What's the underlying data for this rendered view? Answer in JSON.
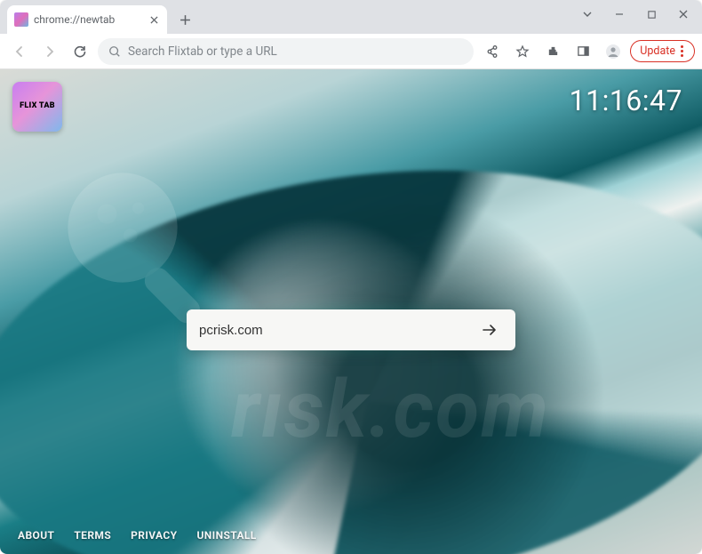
{
  "tab": {
    "title": "chrome://newtab"
  },
  "omnibox": {
    "placeholder": "Search Flixtab or type a URL"
  },
  "update_button": {
    "label": "Update"
  },
  "newtab": {
    "logo_text": "FLIX TAB",
    "clock": "11:16:47",
    "search_value": "pcrisk.com",
    "footer": [
      "ABOUT",
      "TERMS",
      "PRIVACY",
      "UNINSTALL"
    ]
  }
}
